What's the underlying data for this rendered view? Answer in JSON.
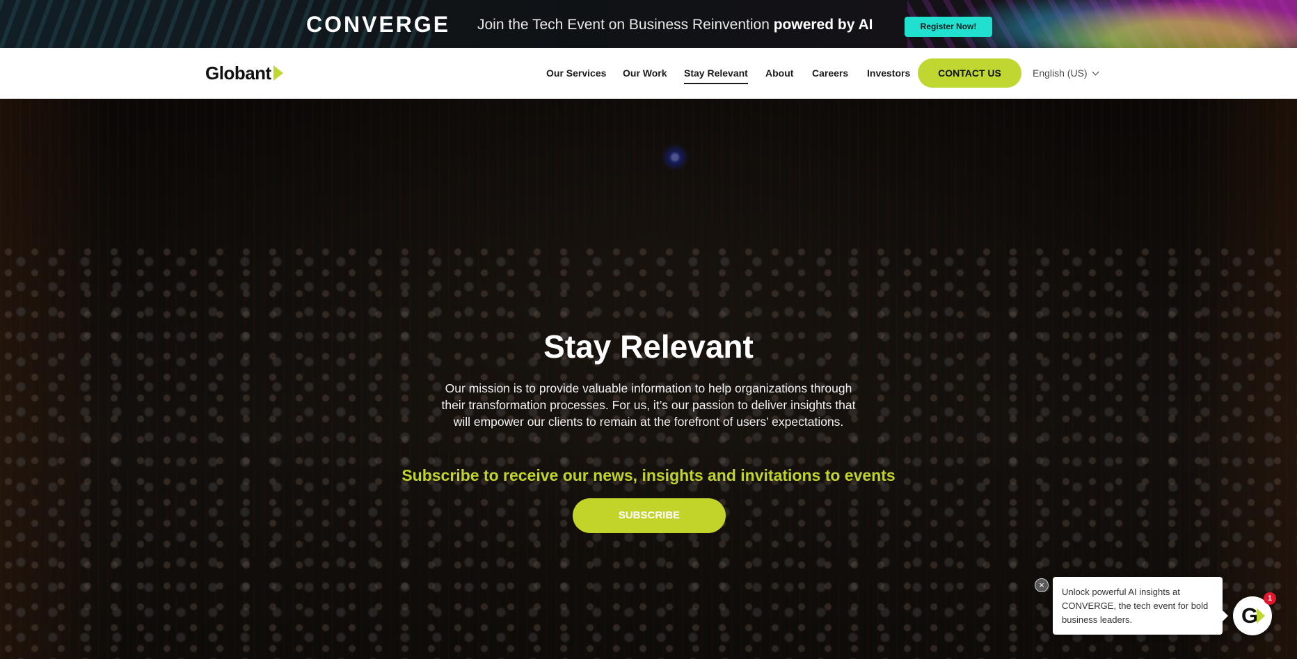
{
  "promo": {
    "logo": "CONVERGE",
    "tagline_prefix": "Join the Tech Event on Business Reinvention ",
    "tagline_bold": "powered by AI",
    "register_label": "Register Now!"
  },
  "header": {
    "brand": "Globant",
    "brand_accent_color": "#bfd730",
    "nav": [
      {
        "label": "Our Services"
      },
      {
        "label": "Our Work"
      },
      {
        "label": "Stay Relevant",
        "active": true
      },
      {
        "label": "About"
      },
      {
        "label": "Careers"
      },
      {
        "label": "Investors"
      }
    ],
    "contact_label": "CONTACT US",
    "language": "English (US)"
  },
  "hero": {
    "title": "Stay Relevant",
    "description": "Our mission is to provide valuable information to help organizations through their transformation processes. For us, it’s our passion to deliver insights that will empower our clients to remain at the forefront of users’ expectations.",
    "subtitle": "Subscribe to receive our news, insights and invitations to events",
    "subscribe_label": "SUBSCRIBE",
    "accent_color": "#c2d42a"
  },
  "chat": {
    "close_icon": "×",
    "message": "Unlock powerful AI insights at CONVERGE, the tech event for bold business leaders.",
    "launcher_letter": "G",
    "badge_count": "1"
  }
}
